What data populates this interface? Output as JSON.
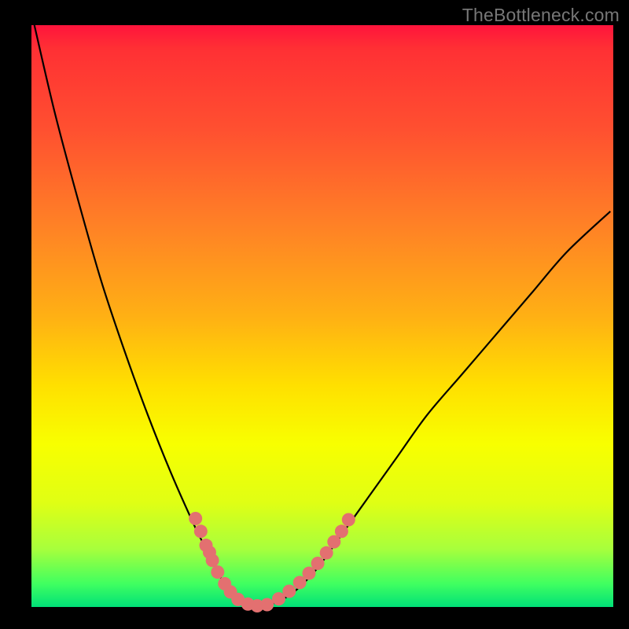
{
  "watermark": "TheBottleneck.com",
  "colors": {
    "background": "#000000",
    "curve_stroke": "#000000",
    "marker_fill": "#e37070",
    "gradient_top": "#ff143c",
    "gradient_bottom": "#00e078"
  },
  "chart_data": {
    "type": "line",
    "title": "",
    "xlabel": "",
    "ylabel": "",
    "xlim": [
      0,
      100
    ],
    "ylim": [
      0,
      100
    ],
    "curve": {
      "x": [
        0.5,
        4,
        8,
        12,
        16,
        20,
        24,
        28,
        30,
        32,
        33.5,
        35,
        37,
        39,
        41.5,
        45,
        49,
        53,
        58,
        63,
        68,
        74,
        80,
        86,
        92,
        99.5
      ],
      "y": [
        100,
        85,
        70,
        56,
        44,
        33,
        23,
        14,
        10,
        6,
        3.5,
        1.8,
        0.6,
        0.2,
        0.6,
        2.5,
        6.5,
        12,
        19,
        26,
        33,
        40,
        47,
        54,
        61,
        68
      ]
    },
    "markers": {
      "x": [
        28.2,
        29.1,
        30.0,
        30.6,
        31.1,
        32.0,
        33.2,
        34.2,
        35.5,
        37.2,
        38.8,
        40.5,
        42.5,
        44.3,
        46.1,
        47.7,
        49.2,
        50.7,
        52.0,
        53.3,
        54.5
      ],
      "y": [
        15.2,
        13.0,
        10.6,
        9.4,
        8.0,
        6.0,
        4.0,
        2.6,
        1.3,
        0.5,
        0.2,
        0.4,
        1.4,
        2.7,
        4.2,
        5.8,
        7.5,
        9.3,
        11.2,
        13.0,
        15.0
      ]
    }
  }
}
